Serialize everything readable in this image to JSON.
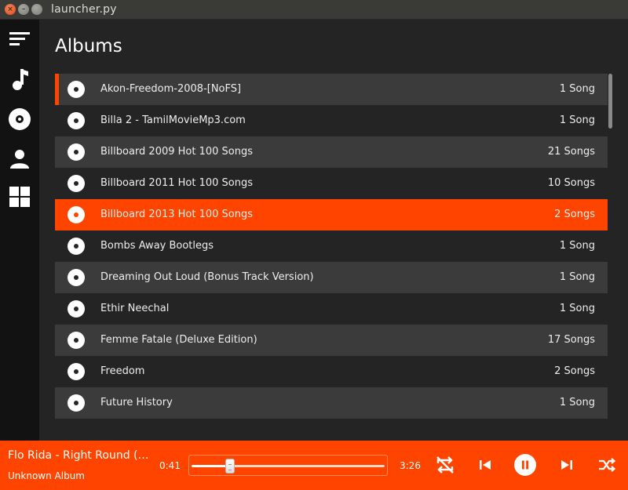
{
  "window": {
    "title": "launcher.py"
  },
  "sidebar": {
    "items": [
      {
        "icon": "menu-icon"
      },
      {
        "icon": "music-note-icon"
      },
      {
        "icon": "album-disc-icon",
        "active": true
      },
      {
        "icon": "artist-person-icon"
      },
      {
        "icon": "grid-icon"
      }
    ]
  },
  "page": {
    "title": "Albums"
  },
  "albums": [
    {
      "name": "Akon-Freedom-2008-[NoFS]",
      "count": "1 Song"
    },
    {
      "name": "Billa 2 - TamilMovieMp3.com",
      "count": "1 Song"
    },
    {
      "name": "Billboard 2009 Hot 100 Songs",
      "count": "21 Songs"
    },
    {
      "name": "Billboard 2011 Hot 100 Songs",
      "count": "10 Songs"
    },
    {
      "name": "Billboard 2013 Hot 100 Songs",
      "count": "2 Songs"
    },
    {
      "name": "Bombs Away Bootlegs",
      "count": "1 Song"
    },
    {
      "name": "Dreaming Out Loud (Bonus Track Version)",
      "count": "1 Song"
    },
    {
      "name": "Ethir Neechal",
      "count": "1 Song"
    },
    {
      "name": "Femme Fatale (Deluxe Edition)",
      "count": "17 Songs"
    },
    {
      "name": "Freedom",
      "count": "2 Songs"
    },
    {
      "name": "Future History",
      "count": "1 Song"
    }
  ],
  "selected_index": 4,
  "accent_index": 0,
  "player": {
    "title": "Flo Rida - Right Round (…",
    "album": "Unknown Album",
    "elapsed": "0:41",
    "total": "3:26",
    "progress": 0.2,
    "buttons": [
      "repeat-off-icon",
      "previous-icon",
      "pause-icon",
      "next-icon",
      "shuffle-icon"
    ]
  },
  "colors": {
    "accent": "#ff4400",
    "sidebar": "#121212",
    "background": "#242424",
    "row_alt": "#3b3b3b"
  }
}
